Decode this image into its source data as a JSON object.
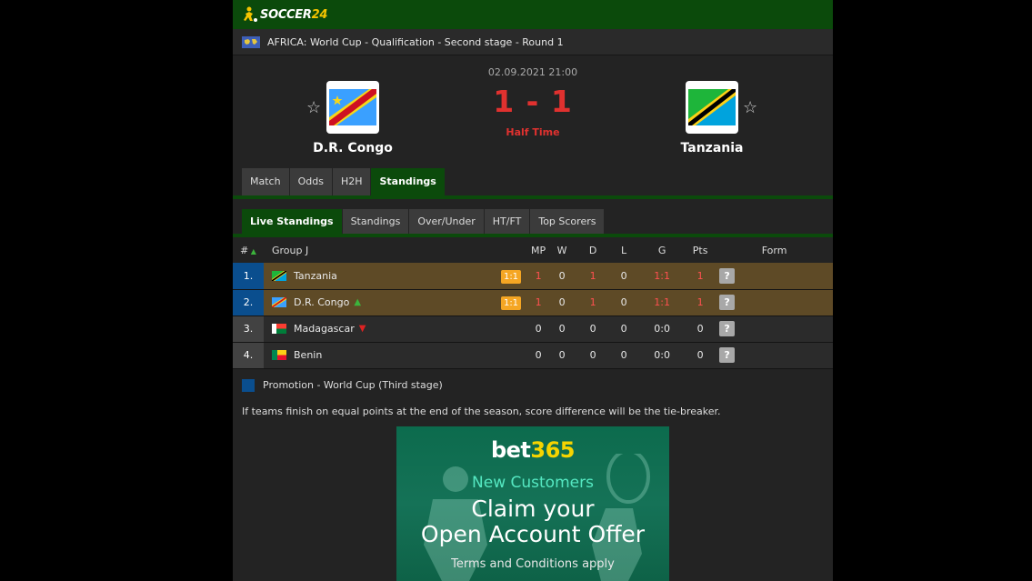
{
  "header": {
    "logo_text": "SOCCER",
    "logo_suffix": "24"
  },
  "competition": {
    "title": "AFRICA: World Cup - Qualification - Second stage - Round 1"
  },
  "match": {
    "datetime": "02.09.2021 21:00",
    "score": "1 - 1",
    "status": "Half Time",
    "home": {
      "name": "D.R. Congo"
    },
    "away": {
      "name": "Tanzania"
    }
  },
  "tabs": [
    "Match",
    "Odds",
    "H2H",
    "Standings"
  ],
  "subtabs": [
    "Live Standings",
    "Standings",
    "Over/Under",
    "HT/FT",
    "Top Scorers"
  ],
  "table": {
    "headers": {
      "rank": "#",
      "group": "Group J",
      "mp": "MP",
      "w": "W",
      "d": "D",
      "l": "L",
      "g": "G",
      "pts": "Pts",
      "form": "Form"
    },
    "rows": [
      {
        "rank": "1.",
        "team": "Tanzania",
        "live": "1:1",
        "mp": "1",
        "w": "0",
        "d": "1",
        "l": "0",
        "g": "1:1",
        "pts": "1",
        "form": "?"
      },
      {
        "rank": "2.",
        "team": "D.R. Congo",
        "live": "1:1",
        "mp": "1",
        "w": "0",
        "d": "1",
        "l": "0",
        "g": "1:1",
        "pts": "1",
        "form": "?"
      },
      {
        "rank": "3.",
        "team": "Madagascar",
        "live": "",
        "mp": "0",
        "w": "0",
        "d": "0",
        "l": "0",
        "g": "0:0",
        "pts": "0",
        "form": "?"
      },
      {
        "rank": "4.",
        "team": "Benin",
        "live": "",
        "mp": "0",
        "w": "0",
        "d": "0",
        "l": "0",
        "g": "0:0",
        "pts": "0",
        "form": "?"
      }
    ]
  },
  "legend": {
    "label": "Promotion - World Cup (Third stage)",
    "color": "#0a4e8e"
  },
  "note": "If teams finish on equal points at the end of the season, score difference will be the tie-breaker.",
  "ad": {
    "brand_a": "bet",
    "brand_b": "365",
    "line1": "New Customers",
    "line2": "Claim your",
    "line3": "Open Account Offer",
    "line4": "Terms and Conditions apply"
  }
}
